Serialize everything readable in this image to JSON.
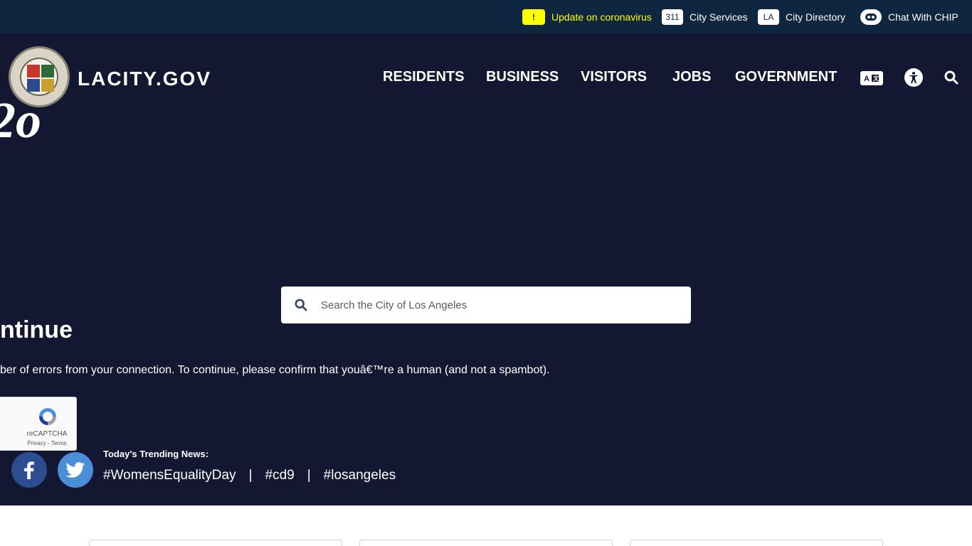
{
  "topbar": {
    "alert_badge": "!",
    "alert_text": "Update on coronavirus",
    "services_badge": "311",
    "services_text": "City Services",
    "directory_badge": "LA",
    "directory_text": "City Directory",
    "chat_text": "Chat With CHIP"
  },
  "header": {
    "brand": "LACITY.GOV",
    "nav": [
      "RESIDENTS",
      "BUSINESS",
      "VISITORS",
      "JOBS",
      "GOVERNMENT"
    ],
    "translate_icon": "translate-icon",
    "accessibility_icon": "accessibility-icon",
    "search_icon": "search-icon"
  },
  "hero": {
    "background_glyph": "2o",
    "search_placeholder": "Search the City of Los Angeles"
  },
  "error": {
    "heading": "ntinue",
    "message": "ber of errors from your connection. To continue, please confirm that youâ€™re a human (and not a spambot)."
  },
  "captcha": {
    "label": "reCAPTCHA",
    "links": "Privacy - Terms"
  },
  "trending": {
    "label": "Today's Trending News:",
    "tags": [
      "#WomensEqualityDay",
      "#cd9",
      "#losangeles"
    ],
    "separator": "|"
  },
  "colors": {
    "topbar_bg": "#0f2640",
    "hero_bg": "#141732",
    "alert_yellow": "#ffff00",
    "facebook": "#2d4d91",
    "twitter": "#4a8ed8"
  }
}
